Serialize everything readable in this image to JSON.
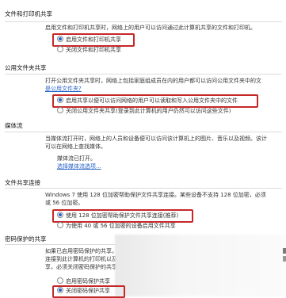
{
  "sections": {
    "file_print": {
      "header": "文件和打印机共享",
      "desc": "启用文件和打印机共享时，网络上的用户可以访问通过此计算机共享的文件和打印机。",
      "options": [
        "启用文件和打印机共享",
        "关闭文件和打印机共享"
      ],
      "selected": 0
    },
    "public_folder": {
      "header": "公用文件夹共享",
      "desc1": "打开公用文件夹共享时，网络上包括家庭组成员在内的用户都可以访问公用文件夹中的文",
      "link": "是公用文件夹?",
      "options": [
        "启用共享以便可以访问网络的用户可以读取和写入公用文件夹中的文件",
        "关闭公用文件夹共享(登录到此计算机的用户仍然可以访问这些文件)"
      ],
      "selected": 0
    },
    "media": {
      "header": "媒体流",
      "desc1": "当媒体流打开时，网络上的人员和设备便可以访问该计算机上的图片、音乐以及视频。该计",
      "desc2": "可以在网络上查找媒体。",
      "status": "媒体流已打开。",
      "link": "选择媒体流选项..."
    },
    "connections": {
      "header": "文件共享连接",
      "desc1": "Windows 7 使用 128 位加密帮助保护文件共享连接。某些设备不支持 128 位加密，必须",
      "desc2": "或 56 位加密。",
      "options": [
        "使用 128 位加密帮助保护文件共享连接(推荐)",
        "为使用 40 或 56 位加密的设备启用文件共享"
      ],
      "selected": 0
    },
    "password": {
      "header": "密码保护的共享",
      "desc1": "如果已启用密码保护的共享，则",
      "desc2": "连接到此计算机的打印机以及",
      "desc3": "享，必须关闭密码保护的共享。",
      "options": [
        "启用密码保护共享",
        "关闭密码保护共享"
      ],
      "selected": 1
    }
  }
}
